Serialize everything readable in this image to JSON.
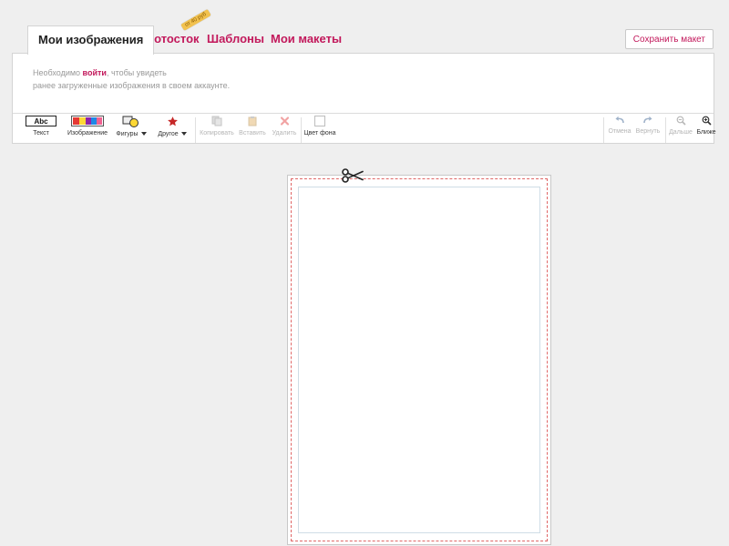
{
  "tabs": [
    {
      "label": "Мои изображения",
      "active": true
    },
    {
      "label": "Фотосток",
      "active": false
    },
    {
      "label": "Шаблоны",
      "active": false
    },
    {
      "label": "Мои макеты",
      "active": false
    }
  ],
  "price_badge": "от 40 руб",
  "save_button": "Сохранить макет",
  "login_message": {
    "prefix": "Необходимо ",
    "link": "войти",
    "suffix": ", чтобы увидеть",
    "line2": "ранее загруженные изображения в своем аккаунте."
  },
  "toolbar": {
    "text": {
      "label": "Текст",
      "icon": "text-abc-icon",
      "icon_text": "Abc"
    },
    "image": {
      "label": "Изображение",
      "icon": "image-icon"
    },
    "shapes": {
      "label": "Фигуры",
      "icon": "shapes-icon"
    },
    "other": {
      "label": "Другое",
      "icon": "star-icon"
    },
    "copy": {
      "label": "Копировать",
      "icon": "copy-icon",
      "enabled": false
    },
    "paste": {
      "label": "Вставить",
      "icon": "paste-icon",
      "enabled": false
    },
    "delete": {
      "label": "Удалить",
      "icon": "delete-icon",
      "enabled": false
    },
    "bg_color": {
      "label": "Цвет фона",
      "icon": "color-swatch-icon"
    },
    "undo": {
      "label": "Отмена",
      "icon": "undo-icon",
      "enabled": false
    },
    "redo": {
      "label": "Вернуть",
      "icon": "redo-icon",
      "enabled": false
    },
    "zoom_out": {
      "label": "Дальше",
      "icon": "zoom-out-icon",
      "enabled": false
    },
    "zoom_in": {
      "label": "Ближе",
      "icon": "zoom-in-icon",
      "enabled": true
    }
  },
  "colors": {
    "accent": "#c2185b",
    "cut_line": "#e06666",
    "background": "#efefef",
    "badge": "#f2c24f"
  }
}
